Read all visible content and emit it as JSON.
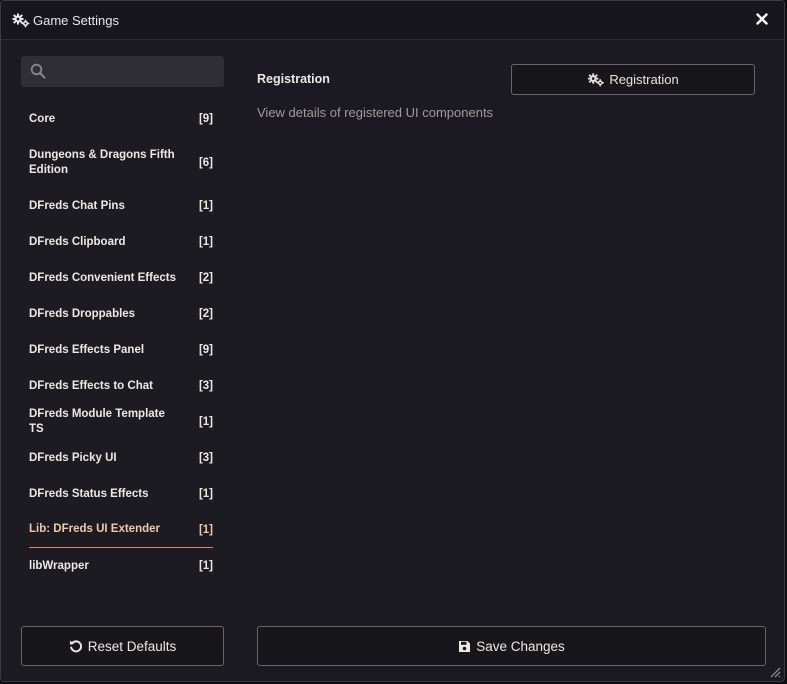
{
  "window": {
    "title": "Game Settings"
  },
  "search": {
    "value": "",
    "placeholder": ""
  },
  "categories": [
    {
      "name": "Core",
      "count": "[9]"
    },
    {
      "name": "Dungeons & Dragons Fifth Edition",
      "count": "[6]"
    },
    {
      "name": "DFreds Chat Pins",
      "count": "[1]"
    },
    {
      "name": "DFreds Clipboard",
      "count": "[1]"
    },
    {
      "name": "DFreds Convenient Effects",
      "count": "[2]"
    },
    {
      "name": "DFreds Droppables",
      "count": "[2]"
    },
    {
      "name": "DFreds Effects Panel",
      "count": "[9]"
    },
    {
      "name": "DFreds Effects to Chat",
      "count": "[3]"
    },
    {
      "name": "DFreds Module Template TS",
      "count": "[1]"
    },
    {
      "name": "DFreds Picky UI",
      "count": "[3]"
    },
    {
      "name": "DFreds Status Effects",
      "count": "[1]"
    },
    {
      "name": "Lib: DFreds UI Extender",
      "count": "[1]"
    },
    {
      "name": "libWrapper",
      "count": "[1]"
    }
  ],
  "active_category": "Lib: DFreds UI Extender",
  "sidebar": {
    "reset_label": "Reset Defaults"
  },
  "main": {
    "section_heading": "Registration",
    "registration_button_label": "Registration",
    "description": "View details of registered UI components",
    "save_label": "Save Changes"
  },
  "colors": {
    "background": "#1b1a22",
    "accent": "#d8865e",
    "text": "#ece8e3",
    "muted_text": "#a39a94",
    "button_border": "#6b6469"
  },
  "icons": {
    "title": "gears-icon",
    "close": "close-icon",
    "search": "search-icon",
    "registration": "gears-icon",
    "reset": "undo-icon",
    "save": "save-icon"
  }
}
